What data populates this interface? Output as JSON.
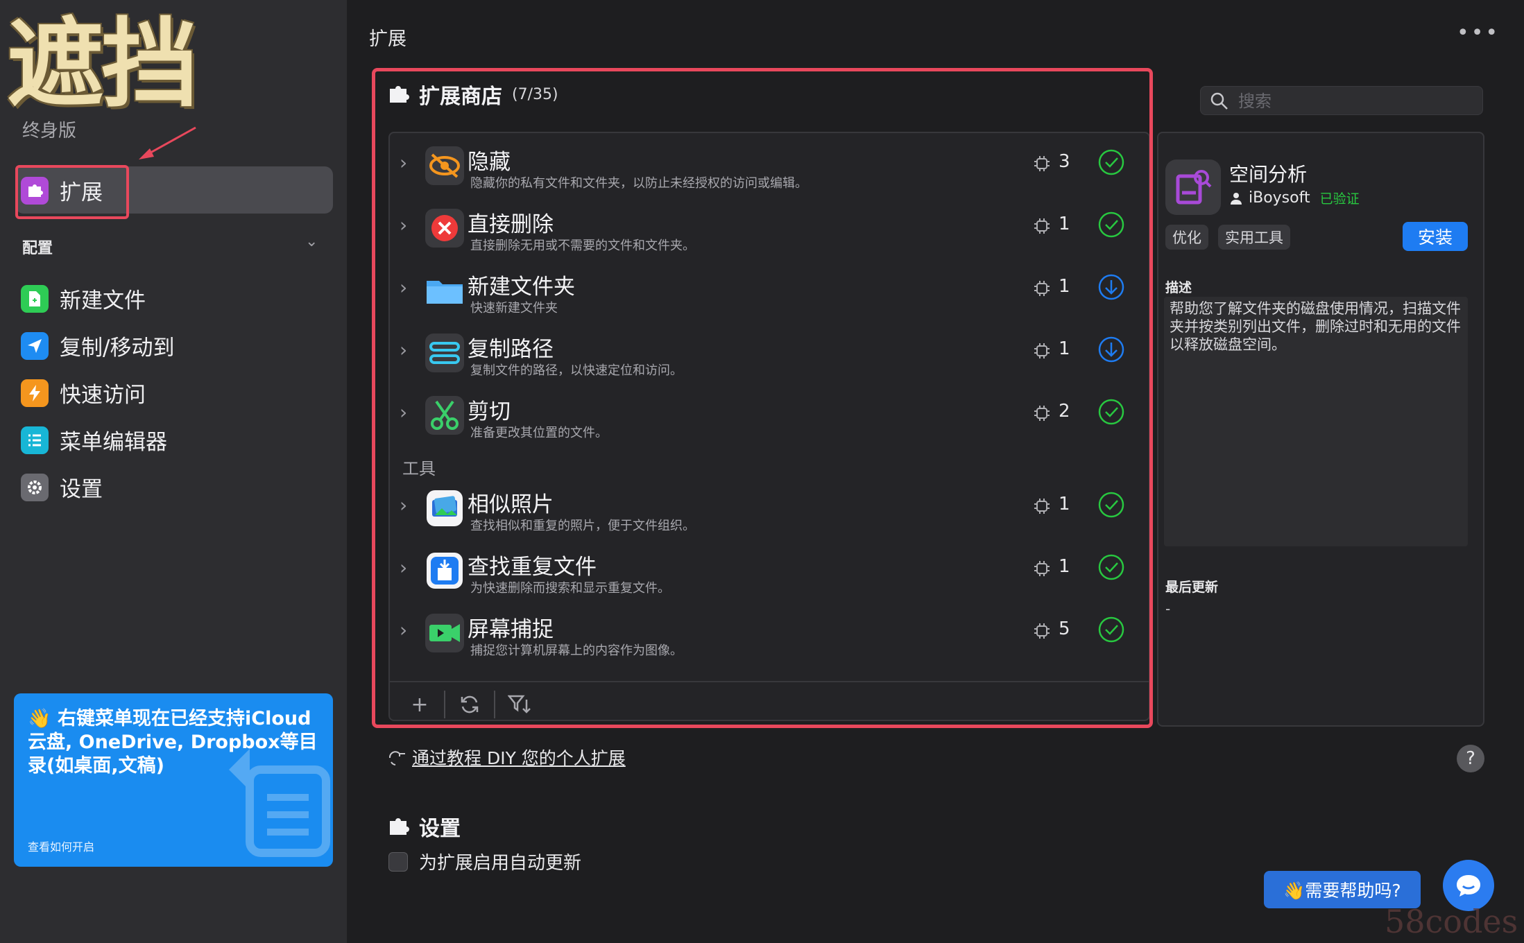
{
  "sidebar": {
    "brand": "遮挡",
    "edition": "终身版",
    "active_item": "扩展",
    "section_label": "配置",
    "items": [
      {
        "label": "新建文件",
        "icon": "new-file-icon",
        "color": "#2ecc55"
      },
      {
        "label": "复制/移动到",
        "icon": "paper-plane-icon",
        "color": "#1e8cf2"
      },
      {
        "label": "快速访问",
        "icon": "lightning-icon",
        "color": "#f5961e"
      },
      {
        "label": "菜单编辑器",
        "icon": "list-icon",
        "color": "#18b6d6"
      },
      {
        "label": "设置",
        "icon": "gear-icon",
        "color": "#6a6a70"
      }
    ],
    "promo": {
      "text": "👋 右键菜单现在已经支持iCloud云盘, OneDrive, Dropbox等目录(如桌面,文稿)",
      "link": "查看如何开启"
    }
  },
  "main": {
    "title": "扩展",
    "store": {
      "title": "扩展商店",
      "count": "(7/35)",
      "group_label": "工具",
      "rows": [
        {
          "title": "隐藏",
          "desc": "隐藏你的私有文件和文件夹，以防止未经授权的访问或编辑。",
          "num": "3",
          "status": "installed"
        },
        {
          "title": "直接删除",
          "desc": "直接删除无用或不需要的文件和文件夹。",
          "num": "1",
          "status": "installed"
        },
        {
          "title": "新建文件夹",
          "desc": "快速新建文件夹",
          "num": "1",
          "status": "download"
        },
        {
          "title": "复制路径",
          "desc": "复制文件的路径，以快速定位和访问。",
          "num": "1",
          "status": "download"
        },
        {
          "title": "剪切",
          "desc": "准备更改其位置的文件。",
          "num": "2",
          "status": "installed"
        },
        {
          "title": "相似照片",
          "desc": "查找相似和重复的照片，便于文件组织。",
          "num": "1",
          "status": "installed"
        },
        {
          "title": "查找重复文件",
          "desc": "为快速删除而搜索和显示重复文件。",
          "num": "1",
          "status": "installed"
        },
        {
          "title": "屏幕捕捉",
          "desc": "捕捉您计算机屏幕上的内容作为图像。",
          "num": "5",
          "status": "installed"
        }
      ]
    },
    "diy_link": "通过教程 DIY 您的个人扩展",
    "settings_title": "设置",
    "auto_update_label": "为扩展启用自动更新",
    "help_button": "👋需要帮助吗?"
  },
  "detail": {
    "search_placeholder": "搜索",
    "name": "空间分析",
    "author": "iBoysoft",
    "verified": "已验证",
    "tags": [
      "优化",
      "实用工具"
    ],
    "install": "安装",
    "desc_label": "描述",
    "desc": "帮助您了解文件夹的磁盘使用情况，扫描文件夹并按类别列出文件，删除过时和无用的文件以释放磁盘空间。",
    "updated_label": "最后更新",
    "updated_value": "-"
  },
  "watermark": "58codes",
  "colors": {
    "accent": "#1e7cf2",
    "highlight_frame": "#e8485c",
    "installed": "#28c840",
    "verified": "#28c840"
  }
}
